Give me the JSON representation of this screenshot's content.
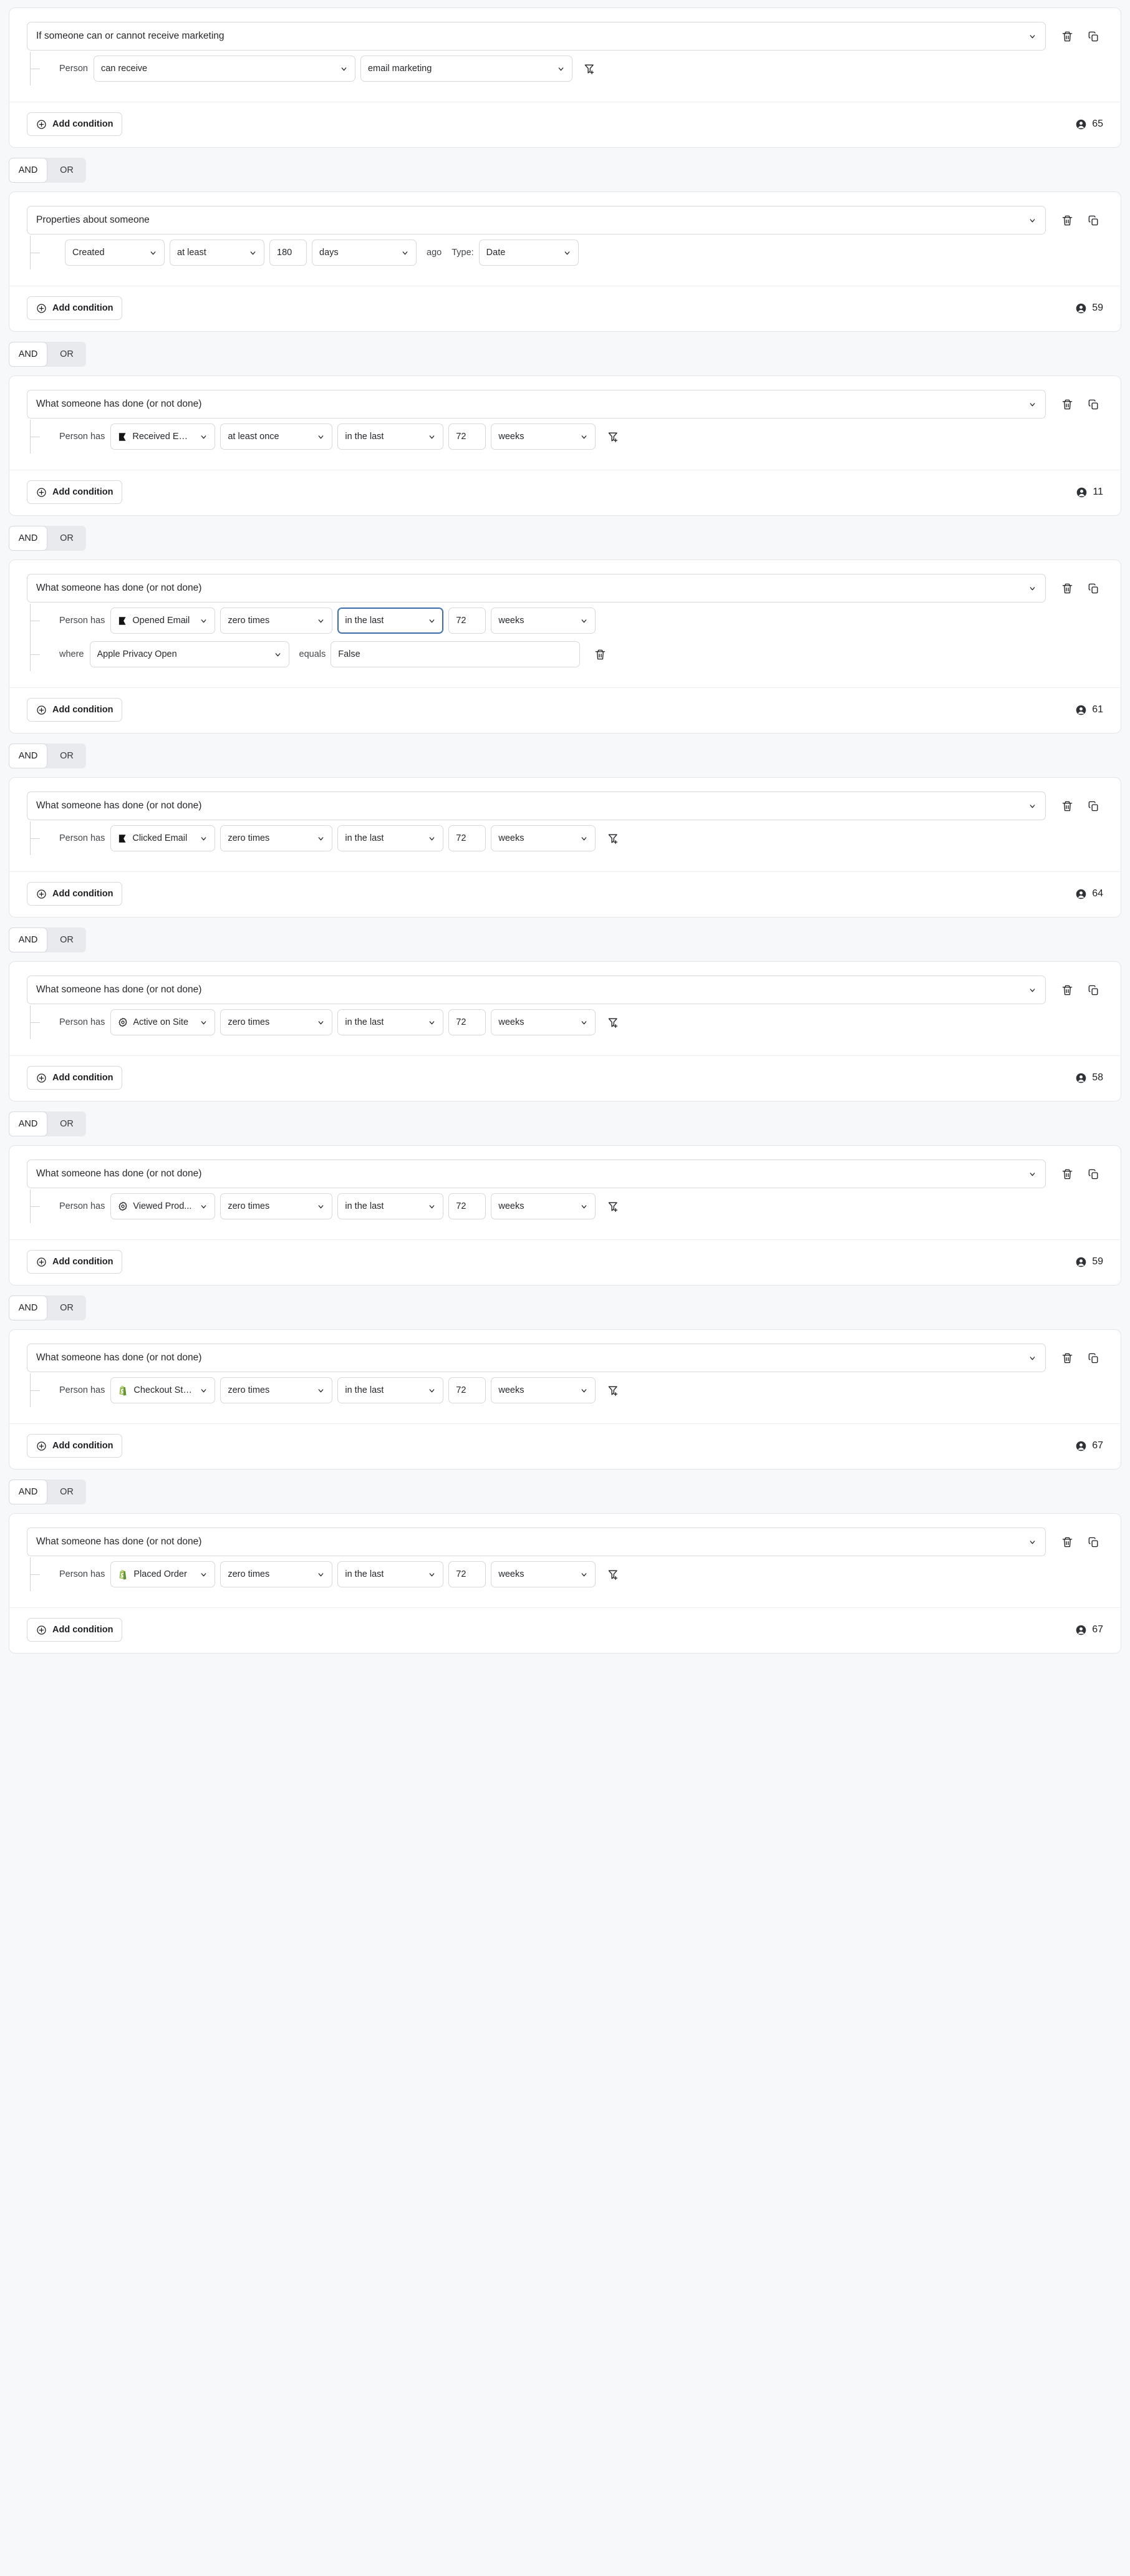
{
  "labels": {
    "add_condition": "Add condition",
    "and": "AND",
    "or": "OR",
    "person": "Person",
    "person_has": "Person has",
    "where": "where",
    "equals": "equals",
    "ago": "ago",
    "type": "Type:"
  },
  "colors": {
    "page_bg": "#f7f8fa",
    "card_bg": "#ffffff",
    "border": "#d6d9dd",
    "focus_blue": "#3c6ca8",
    "shopify_green": "#95bf47",
    "klaviyo_black": "#1a1a1a"
  },
  "groups": [
    {
      "title": "If someone can or cannot receive marketing",
      "count": "65",
      "rows": [
        {
          "kind": "person-marketing",
          "label": "Person",
          "fields": [
            {
              "name": "marketing-ability-select",
              "value": "can receive",
              "width": "w-person",
              "control": "select"
            },
            {
              "name": "marketing-channel-select",
              "value": "email marketing",
              "width": "w-chan",
              "control": "select"
            }
          ],
          "trailing": "filter-add-icon"
        }
      ]
    },
    {
      "title": "Properties about someone",
      "count": "59",
      "rows": [
        {
          "kind": "property",
          "label": "",
          "fields": [
            {
              "name": "property-name-select",
              "value": "Created",
              "width": "w-prop",
              "control": "select"
            },
            {
              "name": "property-operator-select",
              "value": "at least",
              "width": "w-pop",
              "control": "select"
            },
            {
              "name": "property-value-input",
              "value": "180",
              "width": "w-pnum",
              "control": "input"
            },
            {
              "name": "property-unit-select",
              "value": "days",
              "width": "w-punit",
              "control": "select"
            }
          ],
          "midtext": "ago",
          "typetext": "Type:",
          "typefield": {
            "name": "property-type-select",
            "value": "Date",
            "width": "w-ptype",
            "control": "select"
          }
        }
      ]
    },
    {
      "title": "What someone has done (or not done)",
      "count": "11",
      "rows": [
        {
          "kind": "metric",
          "label": "Person has",
          "icon": "klaviyo-flag-icon",
          "fields": [
            {
              "name": "metric-select",
              "value": "Received Email",
              "width": "w-metric",
              "control": "select"
            },
            {
              "name": "frequency-select",
              "value": "at least once",
              "width": "w-op",
              "control": "select"
            },
            {
              "name": "timeframe-select",
              "value": "in the last",
              "width": "w-when",
              "control": "select"
            },
            {
              "name": "timeframe-value-input",
              "value": "72",
              "width": "w-num",
              "control": "input"
            },
            {
              "name": "timeframe-unit-select",
              "value": "weeks",
              "width": "w-unit",
              "control": "select"
            }
          ],
          "trailing": "filter-add-icon"
        }
      ]
    },
    {
      "title": "What someone has done (or not done)",
      "count": "61",
      "rows": [
        {
          "kind": "metric",
          "label": "Person has",
          "icon": "klaviyo-flag-icon",
          "fields": [
            {
              "name": "metric-select",
              "value": "Opened Email",
              "width": "w-metric",
              "control": "select"
            },
            {
              "name": "frequency-select",
              "value": "zero times",
              "width": "w-op",
              "control": "select"
            },
            {
              "name": "timeframe-select",
              "value": "in the last",
              "width": "w-when",
              "control": "select",
              "focused": true
            },
            {
              "name": "timeframe-value-input",
              "value": "72",
              "width": "w-num",
              "control": "input"
            },
            {
              "name": "timeframe-unit-select",
              "value": "weeks",
              "width": "w-unit",
              "control": "select"
            }
          ]
        },
        {
          "kind": "where",
          "label": "where",
          "fields": [
            {
              "name": "where-property-select",
              "value": "Apple Privacy Open",
              "width": "w-wprop",
              "control": "select"
            }
          ],
          "equals_label": "equals",
          "equals_field": {
            "name": "where-value-input",
            "value": "False",
            "width": "w-wval",
            "control": "input"
          },
          "trailing": "trash-icon"
        }
      ]
    },
    {
      "title": "What someone has done (or not done)",
      "count": "64",
      "rows": [
        {
          "kind": "metric",
          "label": "Person has",
          "icon": "klaviyo-flag-icon",
          "fields": [
            {
              "name": "metric-select",
              "value": "Clicked Email",
              "width": "w-metric",
              "control": "select"
            },
            {
              "name": "frequency-select",
              "value": "zero times",
              "width": "w-op",
              "control": "select"
            },
            {
              "name": "timeframe-select",
              "value": "in the last",
              "width": "w-when",
              "control": "select"
            },
            {
              "name": "timeframe-value-input",
              "value": "72",
              "width": "w-num",
              "control": "input"
            },
            {
              "name": "timeframe-unit-select",
              "value": "weeks",
              "width": "w-unit",
              "control": "select"
            }
          ],
          "trailing": "filter-add-icon"
        }
      ]
    },
    {
      "title": "What someone has done (or not done)",
      "count": "58",
      "rows": [
        {
          "kind": "metric",
          "label": "Person has",
          "icon": "gear-icon",
          "fields": [
            {
              "name": "metric-select",
              "value": "Active on Site",
              "width": "w-metric",
              "control": "select"
            },
            {
              "name": "frequency-select",
              "value": "zero times",
              "width": "w-op",
              "control": "select"
            },
            {
              "name": "timeframe-select",
              "value": "in the last",
              "width": "w-when",
              "control": "select"
            },
            {
              "name": "timeframe-value-input",
              "value": "72",
              "width": "w-num",
              "control": "input"
            },
            {
              "name": "timeframe-unit-select",
              "value": "weeks",
              "width": "w-unit",
              "control": "select"
            }
          ],
          "trailing": "filter-add-icon"
        }
      ]
    },
    {
      "title": "What someone has done (or not done)",
      "count": "59",
      "rows": [
        {
          "kind": "metric",
          "label": "Person has",
          "icon": "gear-icon",
          "fields": [
            {
              "name": "metric-select",
              "value": "Viewed Prod...",
              "width": "w-metric",
              "control": "select"
            },
            {
              "name": "frequency-select",
              "value": "zero times",
              "width": "w-op",
              "control": "select"
            },
            {
              "name": "timeframe-select",
              "value": "in the last",
              "width": "w-when",
              "control": "select"
            },
            {
              "name": "timeframe-value-input",
              "value": "72",
              "width": "w-num",
              "control": "input"
            },
            {
              "name": "timeframe-unit-select",
              "value": "weeks",
              "width": "w-unit",
              "control": "select"
            }
          ],
          "trailing": "filter-add-icon"
        }
      ]
    },
    {
      "title": "What someone has done (or not done)",
      "count": "67",
      "rows": [
        {
          "kind": "metric",
          "label": "Person has",
          "icon": "shopify-icon",
          "fields": [
            {
              "name": "metric-select",
              "value": "Checkout Sta...",
              "width": "w-metric",
              "control": "select"
            },
            {
              "name": "frequency-select",
              "value": "zero times",
              "width": "w-op",
              "control": "select"
            },
            {
              "name": "timeframe-select",
              "value": "in the last",
              "width": "w-when",
              "control": "select"
            },
            {
              "name": "timeframe-value-input",
              "value": "72",
              "width": "w-num",
              "control": "input"
            },
            {
              "name": "timeframe-unit-select",
              "value": "weeks",
              "width": "w-unit",
              "control": "select"
            }
          ],
          "trailing": "filter-add-icon"
        }
      ]
    },
    {
      "title": "What someone has done (or not done)",
      "count": "67",
      "rows": [
        {
          "kind": "metric",
          "label": "Person has",
          "icon": "shopify-icon",
          "fields": [
            {
              "name": "metric-select",
              "value": "Placed Order",
              "width": "w-metric",
              "control": "select"
            },
            {
              "name": "frequency-select",
              "value": "zero times",
              "width": "w-op",
              "control": "select"
            },
            {
              "name": "timeframe-select",
              "value": "in the last",
              "width": "w-when",
              "control": "select"
            },
            {
              "name": "timeframe-value-input",
              "value": "72",
              "width": "w-num",
              "control": "input"
            },
            {
              "name": "timeframe-unit-select",
              "value": "weeks",
              "width": "w-unit",
              "control": "select"
            }
          ],
          "trailing": "filter-add-icon"
        }
      ]
    }
  ]
}
